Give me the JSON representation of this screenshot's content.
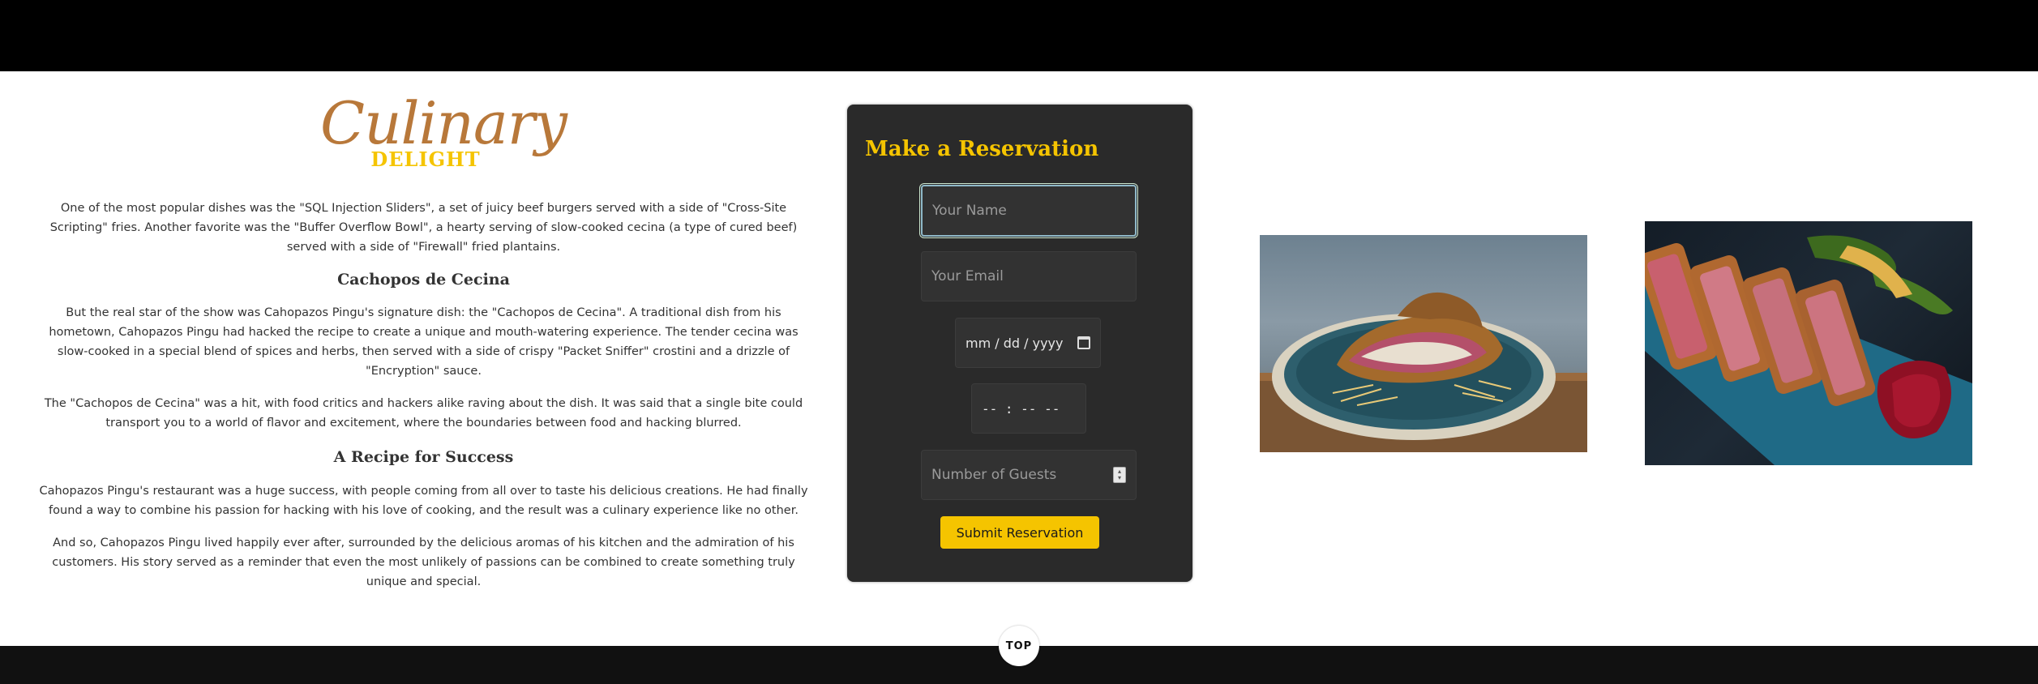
{
  "logo": {
    "script": "Culinary",
    "sub": "DELIGHT"
  },
  "content": {
    "p1": "One of the most popular dishes was the \"SQL Injection Sliders\", a set of juicy beef burgers served with a side of \"Cross-Site Scripting\" fries. Another favorite was the \"Buffer Overflow Bowl\", a hearty serving of slow-cooked cecina (a type of cured beef) served with a side of \"Firewall\" fried plantains.",
    "h1": "Cachopos de Cecina",
    "p2": "But the real star of the show was Cahopazos Pingu's signature dish: the \"Cachopos de Cecina\". A traditional dish from his hometown, Cahopazos Pingu had hacked the recipe to create a unique and mouth-watering experience. The tender cecina was slow-cooked in a special blend of spices and herbs, then served with a side of crispy \"Packet Sniffer\" crostini and a drizzle of \"Encryption\" sauce.",
    "p3": "The \"Cachopos de Cecina\" was a hit, with food critics and hackers alike raving about the dish. It was said that a single bite could transport you to a world of flavor and excitement, where the boundaries between food and hacking blurred.",
    "h2": "A Recipe for Success",
    "p4": "Cahopazos Pingu's restaurant was a huge success, with people coming from all over to taste his delicious creations. He had finally found a way to combine his passion for hacking with his love of cooking, and the result was a culinary experience like no other.",
    "p5": "And so, Cahopazos Pingu lived happily ever after, surrounded by the delicious aromas of his kitchen and the admiration of his customers. His story served as a reminder that even the most unlikely of passions can be combined to create something truly unique and special."
  },
  "reservation": {
    "title": "Make a Reservation",
    "name_placeholder": "Your Name",
    "email_placeholder": "Your Email",
    "date_placeholder": "mm / dd / yyyy",
    "time_placeholder": "-- : --   --",
    "guests_placeholder": "Number of Guests",
    "submit_label": "Submit Reservation"
  },
  "footer": {
    "top_label": "TOP"
  },
  "colors": {
    "accent": "#f5c400",
    "logo": "#b8783a",
    "card": "#2a2a2a"
  }
}
